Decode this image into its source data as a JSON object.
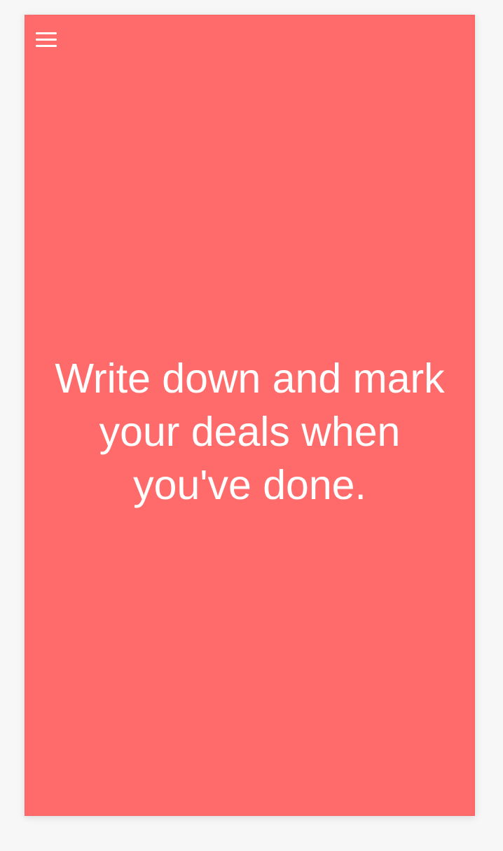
{
  "screen": {
    "background_color": "#ff6b6b",
    "page_background": "#f7f7f7",
    "text_color": "#ffffff"
  },
  "header": {
    "menu_icon": "hamburger-menu-icon"
  },
  "main": {
    "message": "Write down and mark your deals when you've done."
  }
}
